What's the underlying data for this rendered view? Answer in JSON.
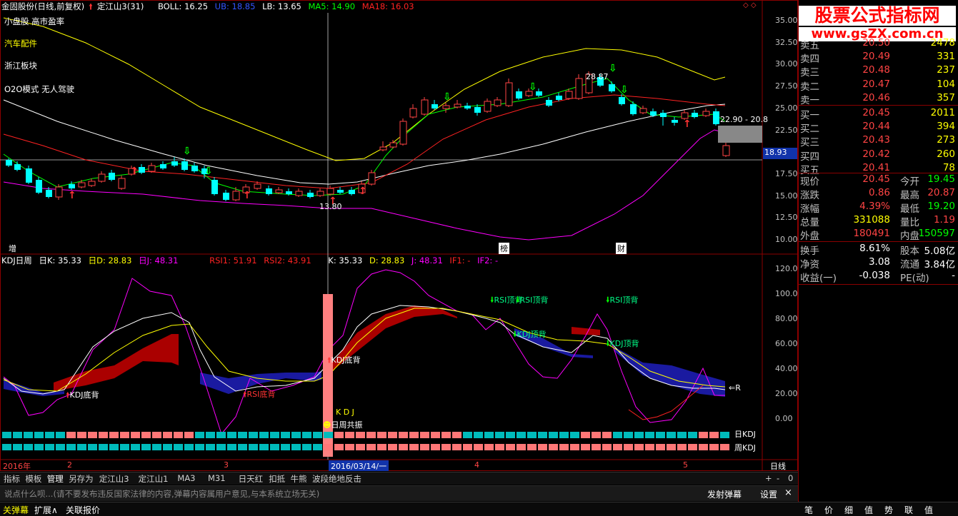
{
  "header": {
    "stock": "金固股份(日线,前复权)",
    "indicator": "定江山3(31)",
    "boll": "BOLL: 16.25",
    "ub": "UB: 18.85",
    "lb": "LB: 13.65",
    "ma5": "MA5: 14.90",
    "ma18": "MA18: 16.03"
  },
  "notes": [
    "小盘股 高市盈率",
    "汽车配件",
    "浙江板块",
    "O2O模式 无人驾驶"
  ],
  "price_axis": [
    "35.00",
    "32.50",
    "30.00",
    "27.50",
    "25.00",
    "22.50",
    "20.00",
    "17.50",
    "15.00",
    "12.50",
    "10.00"
  ],
  "price_tag": "18.93",
  "range_label": "22.90 - 20.8",
  "hi_label": "28.87",
  "lo_label": "13.80",
  "markers": {
    "zeng": "增",
    "bang": "榜",
    "cai": "财"
  },
  "kdj_header": {
    "title": "KDJ日周",
    "rk": "日K: 35.33",
    "rd": "日D: 28.83",
    "rj": "日J: 48.31",
    "rsi1": "RSI1: 51.91",
    "rsi2": "RSI2: 43.91",
    "k": "K: 35.33",
    "d": "D: 28.83",
    "j": "J: 48.31",
    "if1": "IF1: -",
    "if2": "IF2: -"
  },
  "kdj_axis": [
    "120.0",
    "100.0",
    "80.00",
    "60.00",
    "40.00",
    "20.00",
    "0.00"
  ],
  "kdj_labels": {
    "kdj_bottom1": "KDJ底背",
    "rsi_bottom": "RSI底背",
    "kdj_bottom2": "KDJ底背",
    "kdj_word": "K D J",
    "resonance": "日周共振",
    "rsi_top1": "RSI顶背",
    "rsi_top1b": "RSI顶背",
    "kdj_top1": "KDJ顶背",
    "rsi_top2": "RSI顶背",
    "kdj_top2": "KDJ顶背",
    "r": "R",
    "day_kdj": "日KDJ",
    "week_kdj": "周KDJ"
  },
  "date_axis": {
    "y2016": "2016年",
    "m2": "2",
    "m3": "3",
    "cursor": "2016/03/14/一",
    "m4": "4",
    "m5": "5",
    "period": "日线"
  },
  "tabs": [
    "指标",
    "模板",
    "管理",
    "另存为",
    "定江山3",
    "定江山1",
    "MA3",
    "M31",
    "日天红",
    "扣抵",
    "牛熊",
    "波段绝地反击"
  ],
  "tab_controls": [
    "+",
    "-",
    "0"
  ],
  "chat": {
    "placeholder": "说点什么呗...(请不要发布违反国家法律的内容,弹幕内容属用户意见,与本系统立场无关)",
    "send": "发射弹幕",
    "settings": "设置",
    "close": "×"
  },
  "bottom_tabs": [
    "关弹幕",
    "扩展∧",
    "关联报价"
  ],
  "bottom_right": [
    "笔",
    "价",
    "细",
    "值",
    "势",
    "联",
    "值"
  ],
  "logo": {
    "cn": "股票公式指标网",
    "url": "www.gsZX.com.cn"
  },
  "order_book": {
    "asks": [
      {
        "label": "卖五",
        "price": "20.50",
        "vol": "2478"
      },
      {
        "label": "卖四",
        "price": "20.49",
        "vol": "331"
      },
      {
        "label": "卖三",
        "price": "20.48",
        "vol": "237"
      },
      {
        "label": "卖二",
        "price": "20.47",
        "vol": "104"
      },
      {
        "label": "卖一",
        "price": "20.46",
        "vol": "357"
      }
    ],
    "bids": [
      {
        "label": "买一",
        "price": "20.45",
        "vol": "2011"
      },
      {
        "label": "买二",
        "price": "20.44",
        "vol": "394"
      },
      {
        "label": "买三",
        "price": "20.43",
        "vol": "273"
      },
      {
        "label": "买四",
        "price": "20.42",
        "vol": "260"
      },
      {
        "label": "买五",
        "price": "20.41",
        "vol": "78"
      }
    ]
  },
  "quote": [
    {
      "k1": "现价",
      "v1": "20.45",
      "c1": "#ff4444",
      "k2": "今开",
      "v2": "19.45",
      "c2": "#00ff00"
    },
    {
      "k1": "涨跌",
      "v1": "0.86",
      "c1": "#ff4444",
      "k2": "最高",
      "v2": "20.87",
      "c2": "#ff4444"
    },
    {
      "k1": "涨幅",
      "v1": "4.39%",
      "c1": "#ff4444",
      "k2": "最低",
      "v2": "19.20",
      "c2": "#00ff00"
    },
    {
      "k1": "总量",
      "v1": "331088",
      "c1": "#ffff00",
      "k2": "量比",
      "v2": "1.19",
      "c2": "#ff4444"
    },
    {
      "k1": "外盘",
      "v1": "180491",
      "c1": "#ff4444",
      "k2": "内盘",
      "v2": "150597",
      "c2": "#00ff00"
    }
  ],
  "quote2": [
    {
      "k1": "换手",
      "v1": "8.61%",
      "k2": "股本",
      "v2": "5.08亿"
    },
    {
      "k1": "净资",
      "v1": "3.08",
      "k2": "流通",
      "v2": "3.84亿"
    },
    {
      "k1": "收益(一)",
      "v1": "-0.038",
      "k2": "PE(动)",
      "v2": "-"
    }
  ],
  "colors": {
    "up": "#ff4444",
    "down": "#00ffff",
    "ma5": "#00ff00",
    "ma18": "#ff2222",
    "ub": "#ffff00",
    "lb": "#ff00ff",
    "mid": "#ffffff"
  }
}
